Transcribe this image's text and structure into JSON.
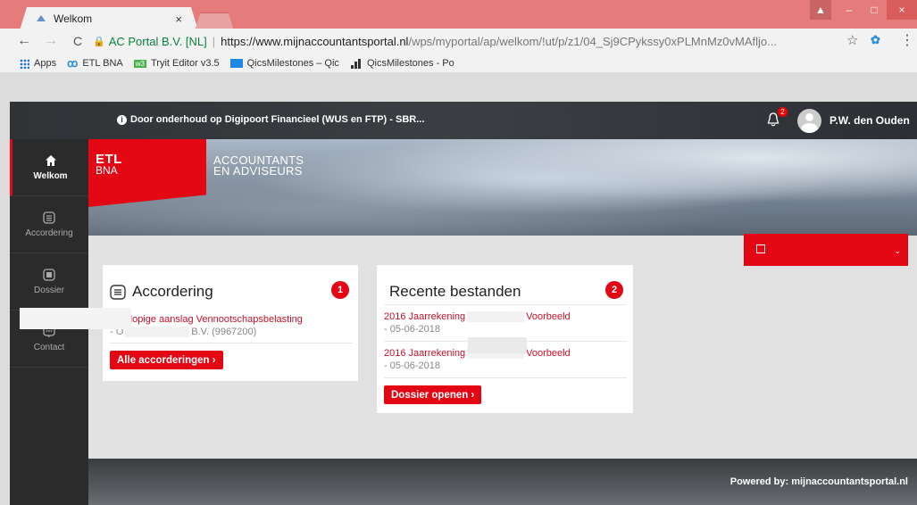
{
  "browser": {
    "tab_title": "Welkom",
    "tab_close": "×",
    "window_controls": {
      "user": "▲",
      "minimize": "–",
      "maximize": "□",
      "close": "×"
    },
    "nav": {
      "back": "←",
      "forward": "→",
      "reload": "C"
    },
    "address": {
      "site_label": "AC Portal B.V. [NL]",
      "separator": "|",
      "host": "https://www.mijnaccountantsportal.nl",
      "path": "/wps/myportal/ap/welkom/!ut/p/z1/04_Sj9CPykssy0xPLMnMz0vMAfljo..."
    },
    "star_icon": "☆",
    "extension_label": "✿",
    "menu_icon": "⋮",
    "bookmarks": [
      {
        "icon": "apps-icon",
        "label": "Apps"
      },
      {
        "icon": "etl-icon",
        "label": "ETL BNA"
      },
      {
        "icon": "tryit-icon",
        "label": "Tryit Editor v3.5"
      },
      {
        "icon": "qm-icon",
        "label": "QicsMilestones – Qic"
      },
      {
        "icon": "chart-icon",
        "label": "QicsMilestones - Po"
      }
    ],
    "bookmark_etl_mark": "ꝏ",
    "bookmark_tryit_mark": "w3"
  },
  "portal": {
    "notice": "Door onderhoud op Digipoort Financieel (WUS en FTP) - SBR...",
    "notice_icon": "i",
    "notifications_count": "2",
    "user_name": "P.W. den Ouden",
    "sidebar": [
      {
        "label": "Welkom",
        "icon": "home-icon",
        "active": true
      },
      {
        "label": "Accordering",
        "icon": "list-icon",
        "active": false
      },
      {
        "label": "Dossier",
        "icon": "folder-icon",
        "active": false
      },
      {
        "label": "Contact",
        "icon": "chat-icon",
        "active": false
      }
    ],
    "logo": {
      "line1": "ETL",
      "line2": "BNA",
      "tagline1": "ACCOUNTANTS",
      "tagline2": "EN ADVISEURS"
    },
    "widget_caret": "⌄",
    "accordering": {
      "title": "Accordering",
      "count": "1",
      "item_link": "Voorlopige aanslag Vennootschapsbelasting",
      "item_sub_prefix": "- O",
      "item_sub_suffix": "B.V. (9967200)",
      "button": "Alle accorderingen ›"
    },
    "recente": {
      "title": "Recente bestanden",
      "count": "2",
      "files": [
        {
          "name_prefix": "2016 Jaarrekening",
          "name_suffix": "Voorbeeld",
          "date": "- 05-06-2018"
        },
        {
          "name_prefix": "2016 Jaarrekening",
          "name_suffix": "Voorbeeld",
          "date": "- 05-06-2018"
        }
      ],
      "button": "Dossier openen ›"
    },
    "footer": "Powered by: mijnaccountantsportal.nl"
  },
  "colors": {
    "brand_red": "#e30613",
    "link_red": "#c4112a",
    "titlebar": "#e57b7b"
  }
}
